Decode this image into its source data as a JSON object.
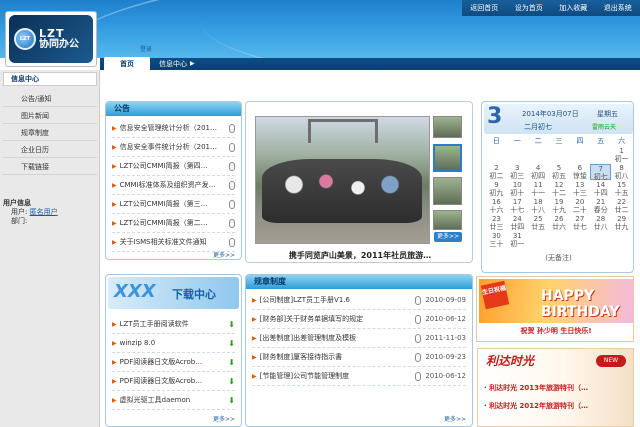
{
  "header": {
    "logo_mark": "LZT",
    "logo_text1": "LZT",
    "logo_text2": "协同办公",
    "top_nav": [
      "返回首页",
      "设为首页",
      "加入收藏",
      "退出系统"
    ],
    "login_link": "登录"
  },
  "nav": {
    "tabs": [
      "首页",
      "信息中心"
    ]
  },
  "sidebar": {
    "heading": "信息中心",
    "items": [
      "公告/通知",
      "图片新闻",
      "规章制度",
      "企业日历",
      "下载链接"
    ],
    "user_title": "用户信息",
    "user_label": "用户:",
    "user_name": "匿名用户",
    "dept_label": "部门:"
  },
  "announcements": {
    "title": "公告",
    "items": [
      "信息安全管理统计分析（201…",
      "信息安全事件统计分析（201…",
      "LZT公司CMMI简报（第四…",
      "CMMI标准体系及组织资产发…",
      "LZT公司CMMI简报（第三…",
      "LZT公司CMMI简报（第二…",
      "关于ISMS相关标准文件通知"
    ],
    "more": "更多>>"
  },
  "photo_news": {
    "caption": "携手同览庐山美景，2011年社员旅游…",
    "more": "更多>>"
  },
  "calendar": {
    "day": "3",
    "date": "2014年03月07日",
    "weekday": "星期五",
    "lunar": "二月初七",
    "extra": "雷雨云天",
    "headers": [
      "日",
      "一",
      "二",
      "三",
      "四",
      "五",
      "六"
    ],
    "cells": [
      {
        "n": "",
        "l": ""
      },
      {
        "n": "",
        "l": ""
      },
      {
        "n": "",
        "l": ""
      },
      {
        "n": "",
        "l": ""
      },
      {
        "n": "",
        "l": ""
      },
      {
        "n": "",
        "l": ""
      },
      {
        "n": "1",
        "l": "初一"
      },
      {
        "n": "2",
        "l": "初二"
      },
      {
        "n": "3",
        "l": "初三"
      },
      {
        "n": "4",
        "l": "初四"
      },
      {
        "n": "5",
        "l": "初五"
      },
      {
        "n": "6",
        "l": "惊蛰"
      },
      {
        "n": "7",
        "l": "初七"
      },
      {
        "n": "8",
        "l": "初八"
      },
      {
        "n": "9",
        "l": "初九"
      },
      {
        "n": "10",
        "l": "初十"
      },
      {
        "n": "11",
        "l": "十一"
      },
      {
        "n": "12",
        "l": "十二"
      },
      {
        "n": "13",
        "l": "十三"
      },
      {
        "n": "14",
        "l": "十四"
      },
      {
        "n": "15",
        "l": "十五"
      },
      {
        "n": "16",
        "l": "十六"
      },
      {
        "n": "17",
        "l": "十七"
      },
      {
        "n": "18",
        "l": "十八"
      },
      {
        "n": "19",
        "l": "十九"
      },
      {
        "n": "20",
        "l": "二十"
      },
      {
        "n": "21",
        "l": "春分"
      },
      {
        "n": "22",
        "l": "廿二"
      },
      {
        "n": "23",
        "l": "廿三"
      },
      {
        "n": "24",
        "l": "廿四"
      },
      {
        "n": "25",
        "l": "廿五"
      },
      {
        "n": "26",
        "l": "廿六"
      },
      {
        "n": "27",
        "l": "廿七"
      },
      {
        "n": "28",
        "l": "廿八"
      },
      {
        "n": "29",
        "l": "廿九"
      },
      {
        "n": "30",
        "l": "三十"
      },
      {
        "n": "31",
        "l": "初一"
      },
      {
        "n": "",
        "l": ""
      },
      {
        "n": "",
        "l": ""
      },
      {
        "n": "",
        "l": ""
      },
      {
        "n": "",
        "l": ""
      },
      {
        "n": "",
        "l": ""
      }
    ],
    "selected": "7",
    "note": "(无备注)"
  },
  "download": {
    "banner": "下载中心",
    "banner_letters": "XXX",
    "items": [
      "LZT员工手册阅读软件",
      "winzip 8.0",
      "PDF阅读器日文版Acrob…",
      "PDF阅读器日文版Acrob…",
      "虚拟光驱工具daemon"
    ],
    "more": "更多>>"
  },
  "rules": {
    "title": "规章制度",
    "items": [
      {
        "text": "[公司制度]LZT员工手册V1.6",
        "date": "2010-09-09"
      },
      {
        "text": "[财务部]关于财务单据填写的规定",
        "date": "2010-06-12"
      },
      {
        "text": "[出差制度]出差管理制度及模板",
        "date": "2011-11-03"
      },
      {
        "text": "[财务制度]厦客接待指示書",
        "date": "2010-09-23"
      },
      {
        "text": "[节能管理]公司节能管理制度",
        "date": "2010-06-12"
      }
    ],
    "more": "更多>>"
  },
  "birthday": {
    "ribbon": "生日祝福",
    "banner": "HAPPY BIRTHDAY",
    "names": "祝贺 孙少明 生日快乐!"
  },
  "travel": {
    "title": "利达时光",
    "badge": "NEW",
    "items": [
      "· 利达时光 2013年旅游特刊（…",
      "· 利达时光 2012年旅游特刊（…"
    ]
  }
}
